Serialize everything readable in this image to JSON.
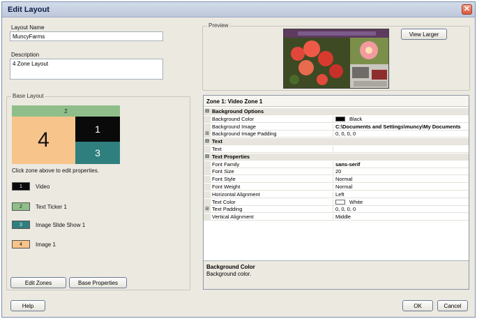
{
  "window": {
    "title": "Edit Layout"
  },
  "layout_name": {
    "label": "Layout Name",
    "value": "MuncyFarms"
  },
  "description": {
    "label": "Description",
    "value": "4 Zone Layout"
  },
  "base_layout": {
    "title": "Base Layout",
    "zones": {
      "z2": "2",
      "z4": "4",
      "z1": "1",
      "z3": "3"
    },
    "hint": "Click zone above to edit properties.",
    "legend": [
      {
        "num": "1",
        "label": "Video",
        "color": "#0a0a0a"
      },
      {
        "num": "2",
        "label": "Text Ticker 1",
        "color": "#8fbe8a"
      },
      {
        "num": "3",
        "label": "Image Slide Show 1",
        "color": "#2f7f7f"
      },
      {
        "num": "4",
        "label": "Image 1",
        "color": "#f7c48c"
      }
    ],
    "edit_zones": "Edit Zones",
    "base_properties": "Base Properties"
  },
  "preview": {
    "title": "Preview",
    "view_larger": "View Larger"
  },
  "properties": {
    "header": "Zone 1: Video Zone 1",
    "rows": [
      {
        "type": "cat",
        "gut": "⊟",
        "name": "Background Options"
      },
      {
        "type": "prop",
        "gut": "",
        "name": "Background Color",
        "value": "Black",
        "swatch": "#000000"
      },
      {
        "type": "prop",
        "gut": "",
        "name": "Background Image",
        "value": "C:\\Documents and Settings\\muncy\\My Documents",
        "bold": true
      },
      {
        "type": "prop",
        "gut": "⊞",
        "name": "Background Image Padding",
        "value": "0, 0, 0, 0"
      },
      {
        "type": "cat",
        "gut": "⊟",
        "name": "Text"
      },
      {
        "type": "prop",
        "gut": "",
        "name": "Text",
        "value": ""
      },
      {
        "type": "cat",
        "gut": "⊟",
        "name": "Text Properties"
      },
      {
        "type": "prop",
        "gut": "",
        "name": "Font Family",
        "value": "sans-serif",
        "bold": true
      },
      {
        "type": "prop",
        "gut": "",
        "name": "Font Size",
        "value": "20"
      },
      {
        "type": "prop",
        "gut": "",
        "name": "Font Style",
        "value": "Normal"
      },
      {
        "type": "prop",
        "gut": "",
        "name": "Font Weight",
        "value": "Normal"
      },
      {
        "type": "prop",
        "gut": "",
        "name": "Horizontal Alignment",
        "value": "Left"
      },
      {
        "type": "prop",
        "gut": "",
        "name": "Text Color",
        "value": "White",
        "swatch": "#ffffff"
      },
      {
        "type": "prop",
        "gut": "⊞",
        "name": "Text Padding",
        "value": "0, 0, 0, 0"
      },
      {
        "type": "prop",
        "gut": "",
        "name": "Vertical Alignment",
        "value": "Middle"
      }
    ],
    "desc_title": "Background Color",
    "desc_text": "Background color."
  },
  "footer": {
    "help": "Help",
    "ok": "OK",
    "cancel": "Cancel"
  }
}
